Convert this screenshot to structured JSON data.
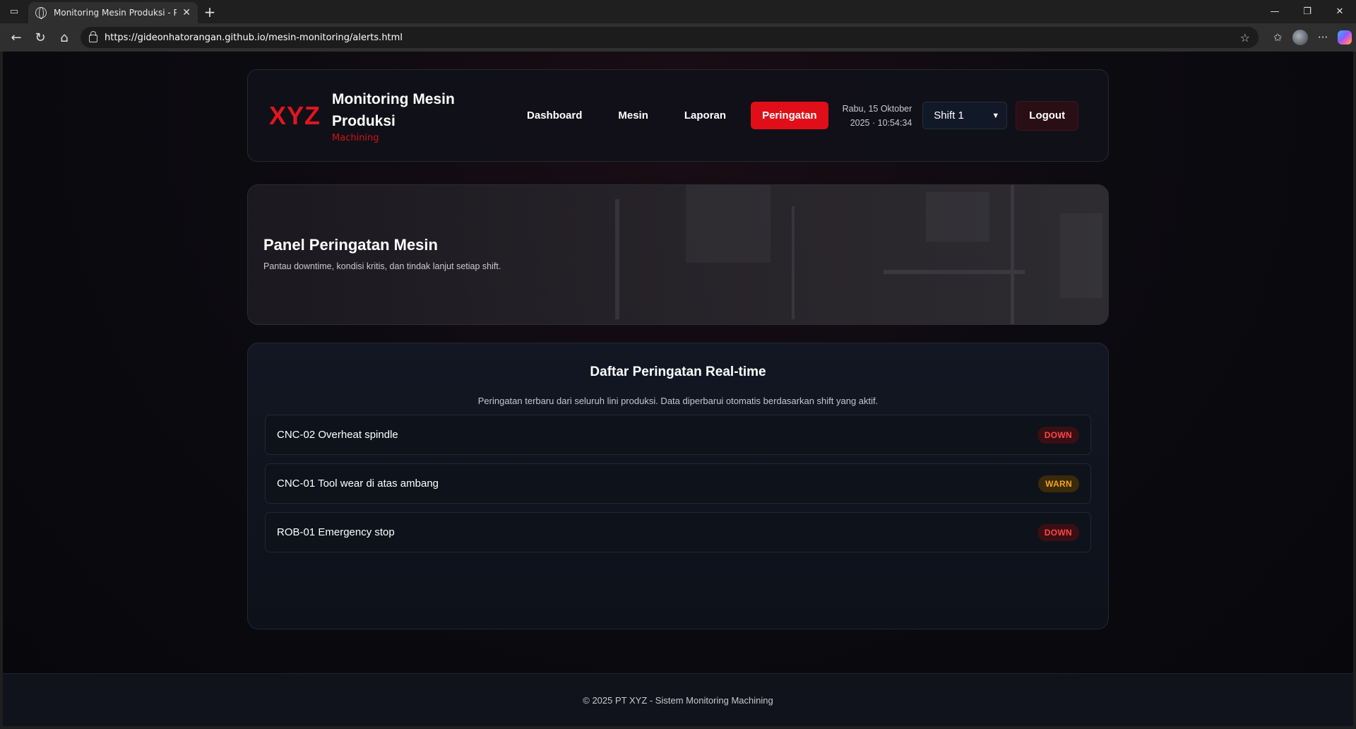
{
  "browser": {
    "tab_title": "Monitoring Mesin Produksi - Peri",
    "url": "https://gideonhatorangan.github.io/mesin-monitoring/alerts.html"
  },
  "header": {
    "logo": "XYZ",
    "title_line1": "Monitoring Mesin",
    "title_line2": "Produksi",
    "subtitle": "Machining",
    "nav": {
      "dashboard": "Dashboard",
      "mesin": "Mesin",
      "laporan": "Laporan",
      "peringatan": "Peringatan"
    },
    "date": "Rabu, 15 Oktober",
    "time": "2025 · 10:54:34",
    "shift": "Shift 1",
    "logout": "Logout"
  },
  "hero": {
    "title": "Panel Peringatan Mesin",
    "subtitle": "Pantau downtime, kondisi kritis, dan tindak lanjut setiap shift."
  },
  "alerts": {
    "title": "Daftar Peringatan Real-time",
    "subtitle": "Peringatan terbaru dari seluruh lini produksi. Data diperbarui otomatis berdasarkan shift yang aktif.",
    "items": [
      {
        "text": "CNC-02 Overheat spindle",
        "status": "DOWN"
      },
      {
        "text": "CNC-01 Tool wear di atas ambang",
        "status": "WARN"
      },
      {
        "text": "ROB-01 Emergency stop",
        "status": "DOWN"
      }
    ]
  },
  "footer": {
    "text": "© 2025 PT XYZ - Sistem Monitoring Machining"
  },
  "colors": {
    "accent": "#e00e18",
    "down": "#ff4646",
    "warn": "#f6a21a"
  }
}
